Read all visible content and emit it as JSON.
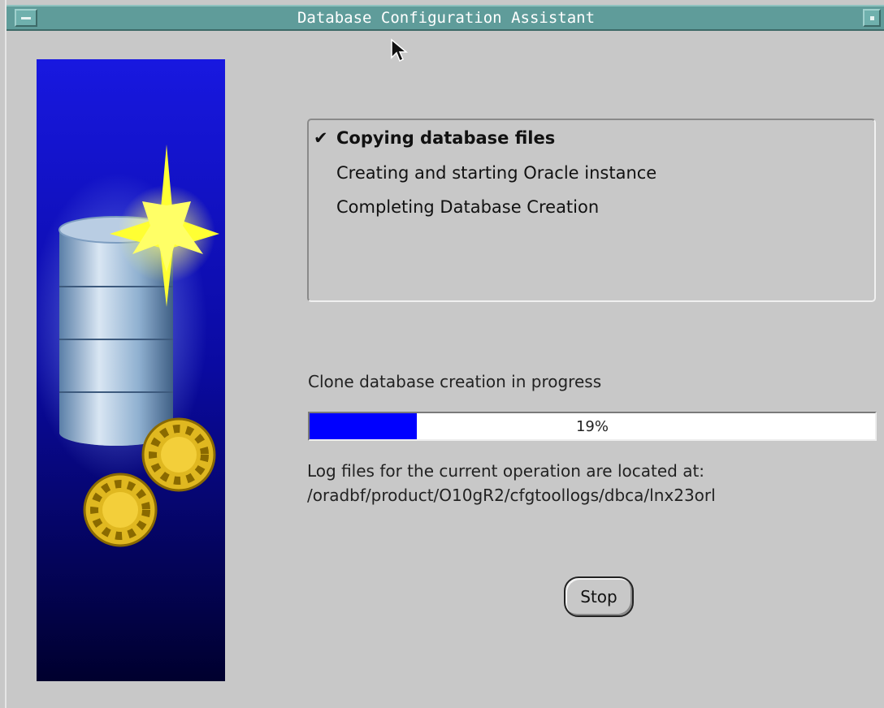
{
  "window": {
    "title": "Database Configuration Assistant"
  },
  "steps": [
    {
      "label": "Copying database files",
      "status": "done",
      "check": "✔"
    },
    {
      "label": "Creating and starting Oracle instance",
      "status": "pending"
    },
    {
      "label": "Completing Database Creation",
      "status": "pending"
    }
  ],
  "progress": {
    "status_text": "Clone database creation in progress",
    "percent": 19,
    "label": "19%",
    "fill_color": "#0000ff"
  },
  "log": {
    "line1": "Log files for the current operation are located at:",
    "line2": "/oradbf/product/O10gR2/cfgtoollogs/dbca/lnx23orl"
  },
  "buttons": {
    "stop_label": "Stop"
  },
  "colors": {
    "titlebar": "#5f9c9a",
    "background": "#c8c8c8",
    "image_gradient_top": "#1414d6",
    "image_gradient_bottom": "#000033"
  },
  "icons": {
    "side_image": "database-with-gears-icon",
    "cursor": "arrow-cursor-icon"
  }
}
